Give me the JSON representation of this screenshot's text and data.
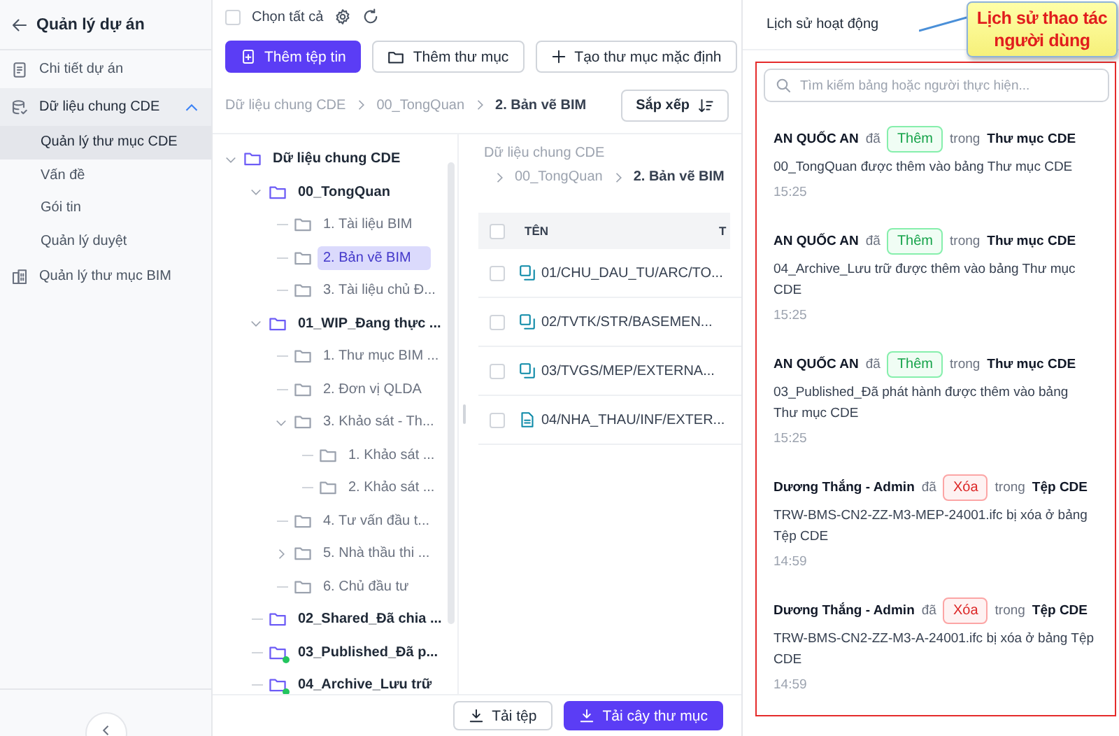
{
  "sidebar": {
    "title": "Quản lý dự án",
    "items": [
      {
        "kind": "link",
        "label": "Chi tiết dự án",
        "selected": false
      },
      {
        "kind": "group",
        "label": "Dữ liệu chung CDE",
        "expanded": true,
        "children": [
          {
            "label": "Quản lý thư mục CDE",
            "selected": true
          },
          {
            "label": "Vấn đề",
            "selected": false
          },
          {
            "label": "Gói tin",
            "selected": false
          },
          {
            "label": "Quản lý duyệt",
            "selected": false
          }
        ]
      },
      {
        "kind": "link",
        "label": "Quản lý thư mục BIM",
        "selected": false
      }
    ]
  },
  "toolbar": {
    "select_all": {
      "label": "Chọn tất cả",
      "checked": false
    },
    "buttons": [
      {
        "kind": "primary",
        "label": "Thêm tệp tin"
      },
      {
        "kind": "folder",
        "label": "Thêm thư mục"
      },
      {
        "kind": "plus",
        "label": "Tạo thư mục mặc định"
      }
    ]
  },
  "breadcrumb": [
    "Dữ liệu chung CDE",
    "00_TongQuan",
    "2. Bản vẽ BIM"
  ],
  "sort_button": "Sắp xếp",
  "tree": {
    "label": "Dữ liệu chung CDE",
    "expanded": true,
    "selected": false,
    "children": [
      {
        "label": "00_TongQuan",
        "expanded": true,
        "selected": false,
        "children": [
          {
            "label": "1. Tài liệu BIM",
            "selected": false
          },
          {
            "label": "2. Bản vẽ BIM",
            "selected": true
          },
          {
            "label": "3. Tài liệu chủ Đ...",
            "selected": false
          }
        ]
      },
      {
        "label": "01_WIP_Đang thực ...",
        "expanded": true,
        "selected": false,
        "children": [
          {
            "label": "1. Thư mục BIM ...",
            "selected": false
          },
          {
            "label": "2. Đơn vị QLDA",
            "selected": false
          },
          {
            "label": "3. Khảo sát - Th...",
            "expanded": true,
            "selected": false,
            "children": [
              {
                "label": "1. Khảo sát ...",
                "selected": false
              },
              {
                "label": "2. Khảo sát ...",
                "selected": false
              }
            ]
          },
          {
            "label": "4. Tư vấn đầu t...",
            "selected": false
          },
          {
            "label": "5. Nhà thầu thi ...",
            "expanded": false,
            "selected": false
          },
          {
            "label": "6. Chủ đầu tư",
            "selected": false
          }
        ]
      },
      {
        "label": "02_Shared_Đã chia ...",
        "selected": false
      },
      {
        "label": "03_Published_Đã p...",
        "selected": false,
        "marked": true
      },
      {
        "label": "04_Archive_Lưu trữ",
        "selected": false,
        "marked": true
      }
    ]
  },
  "files": {
    "breadcrumb": [
      "Dữ liệu chung CDE",
      "00_TongQuan",
      "2. Bản vẽ BIM"
    ],
    "header_checked": false,
    "columns": [
      "TÊN",
      "T"
    ],
    "rows": [
      {
        "kind": "model",
        "name": "01/CHU_DAU_TU/ARC/TO...",
        "checked": false
      },
      {
        "kind": "model",
        "name": "02/TVTK/STR/BASEMEN...",
        "checked": false
      },
      {
        "kind": "model",
        "name": "03/TVGS/MEP/EXTERNA...",
        "checked": false
      },
      {
        "kind": "document",
        "name": "04/NHA_THAU/INF/EXTER...",
        "checked": false
      }
    ]
  },
  "footer_buttons": [
    {
      "kind": "secondary",
      "label": "Tải tệp"
    },
    {
      "kind": "primary",
      "label": "Tải cây thư mục"
    }
  ],
  "activity": {
    "title": "Lịch sử hoạt động",
    "callout": "Lịch sử thao tác người dùng",
    "search": {
      "placeholder": "Tìm kiếm bảng hoặc người thực hiện..."
    },
    "entries": [
      {
        "user": "AN QUỐC AN",
        "verb": "đã",
        "action": {
          "kind": "add",
          "label": "Thêm"
        },
        "prep": "trong",
        "target": "Thư mục CDE",
        "description": "00_TongQuan được thêm vào bảng Thư mục CDE",
        "time": "15:25"
      },
      {
        "user": "AN QUỐC AN",
        "verb": "đã",
        "action": {
          "kind": "add",
          "label": "Thêm"
        },
        "prep": "trong",
        "target": "Thư mục CDE",
        "description": "04_Archive_Lưu trữ được thêm vào bảng Thư mục CDE",
        "time": "15:25"
      },
      {
        "user": "AN QUỐC AN",
        "verb": "đã",
        "action": {
          "kind": "add",
          "label": "Thêm"
        },
        "prep": "trong",
        "target": "Thư mục CDE",
        "description": "03_Published_Đã phát hành được thêm vào bảng Thư mục CDE",
        "time": "15:25"
      },
      {
        "user": "Dương Thắng - Admin",
        "verb": "đã",
        "action": {
          "kind": "delete",
          "label": "Xóa"
        },
        "prep": "trong",
        "target": "Tệp CDE",
        "description": "TRW-BMS-CN2-ZZ-M3-MEP-24001.ifc bị xóa ở bảng Tệp CDE",
        "time": "14:59"
      },
      {
        "user": "Dương Thắng - Admin",
        "verb": "đã",
        "action": {
          "kind": "delete",
          "label": "Xóa"
        },
        "prep": "trong",
        "target": "Tệp CDE",
        "description": "TRW-BMS-CN2-ZZ-M3-A-24001.ifc bị xóa ở bảng Tệp CDE",
        "time": "14:59"
      }
    ]
  }
}
